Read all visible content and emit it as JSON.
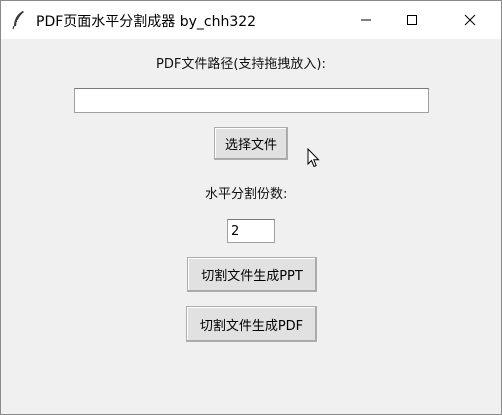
{
  "window": {
    "title": "PDF页面水平分割成器 by_chh322",
    "icon": "feather-icon",
    "controls": [
      "minimize-icon",
      "maximize-icon",
      "close-icon"
    ]
  },
  "form": {
    "path_label": "PDF文件路径(支持拖拽放入):",
    "path_value": "",
    "select_button": "选择文件",
    "count_label": "水平分割份数:",
    "count_value": "2",
    "ppt_button": "切割文件生成PPT",
    "pdf_button": "切割文件生成PDF"
  }
}
